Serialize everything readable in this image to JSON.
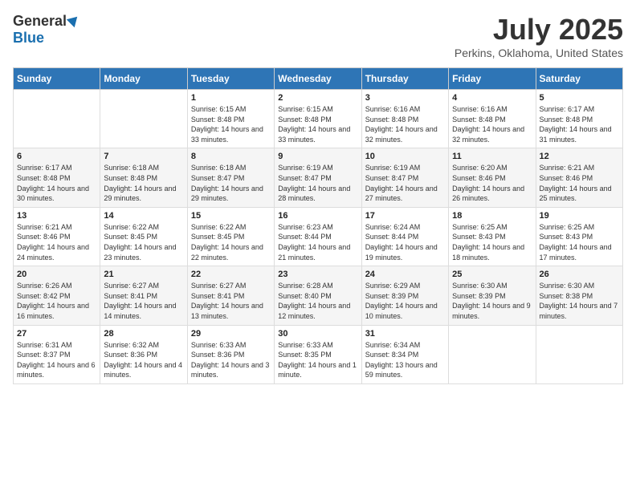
{
  "logo": {
    "general": "General",
    "blue": "Blue"
  },
  "title": "July 2025",
  "location": "Perkins, Oklahoma, United States",
  "days_of_week": [
    "Sunday",
    "Monday",
    "Tuesday",
    "Wednesday",
    "Thursday",
    "Friday",
    "Saturday"
  ],
  "weeks": [
    [
      {
        "day": "",
        "sunrise": "",
        "sunset": "",
        "daylight": ""
      },
      {
        "day": "",
        "sunrise": "",
        "sunset": "",
        "daylight": ""
      },
      {
        "day": "1",
        "sunrise": "Sunrise: 6:15 AM",
        "sunset": "Sunset: 8:48 PM",
        "daylight": "Daylight: 14 hours and 33 minutes."
      },
      {
        "day": "2",
        "sunrise": "Sunrise: 6:15 AM",
        "sunset": "Sunset: 8:48 PM",
        "daylight": "Daylight: 14 hours and 33 minutes."
      },
      {
        "day": "3",
        "sunrise": "Sunrise: 6:16 AM",
        "sunset": "Sunset: 8:48 PM",
        "daylight": "Daylight: 14 hours and 32 minutes."
      },
      {
        "day": "4",
        "sunrise": "Sunrise: 6:16 AM",
        "sunset": "Sunset: 8:48 PM",
        "daylight": "Daylight: 14 hours and 32 minutes."
      },
      {
        "day": "5",
        "sunrise": "Sunrise: 6:17 AM",
        "sunset": "Sunset: 8:48 PM",
        "daylight": "Daylight: 14 hours and 31 minutes."
      }
    ],
    [
      {
        "day": "6",
        "sunrise": "Sunrise: 6:17 AM",
        "sunset": "Sunset: 8:48 PM",
        "daylight": "Daylight: 14 hours and 30 minutes."
      },
      {
        "day": "7",
        "sunrise": "Sunrise: 6:18 AM",
        "sunset": "Sunset: 8:48 PM",
        "daylight": "Daylight: 14 hours and 29 minutes."
      },
      {
        "day": "8",
        "sunrise": "Sunrise: 6:18 AM",
        "sunset": "Sunset: 8:47 PM",
        "daylight": "Daylight: 14 hours and 29 minutes."
      },
      {
        "day": "9",
        "sunrise": "Sunrise: 6:19 AM",
        "sunset": "Sunset: 8:47 PM",
        "daylight": "Daylight: 14 hours and 28 minutes."
      },
      {
        "day": "10",
        "sunrise": "Sunrise: 6:19 AM",
        "sunset": "Sunset: 8:47 PM",
        "daylight": "Daylight: 14 hours and 27 minutes."
      },
      {
        "day": "11",
        "sunrise": "Sunrise: 6:20 AM",
        "sunset": "Sunset: 8:46 PM",
        "daylight": "Daylight: 14 hours and 26 minutes."
      },
      {
        "day": "12",
        "sunrise": "Sunrise: 6:21 AM",
        "sunset": "Sunset: 8:46 PM",
        "daylight": "Daylight: 14 hours and 25 minutes."
      }
    ],
    [
      {
        "day": "13",
        "sunrise": "Sunrise: 6:21 AM",
        "sunset": "Sunset: 8:46 PM",
        "daylight": "Daylight: 14 hours and 24 minutes."
      },
      {
        "day": "14",
        "sunrise": "Sunrise: 6:22 AM",
        "sunset": "Sunset: 8:45 PM",
        "daylight": "Daylight: 14 hours and 23 minutes."
      },
      {
        "day": "15",
        "sunrise": "Sunrise: 6:22 AM",
        "sunset": "Sunset: 8:45 PM",
        "daylight": "Daylight: 14 hours and 22 minutes."
      },
      {
        "day": "16",
        "sunrise": "Sunrise: 6:23 AM",
        "sunset": "Sunset: 8:44 PM",
        "daylight": "Daylight: 14 hours and 21 minutes."
      },
      {
        "day": "17",
        "sunrise": "Sunrise: 6:24 AM",
        "sunset": "Sunset: 8:44 PM",
        "daylight": "Daylight: 14 hours and 19 minutes."
      },
      {
        "day": "18",
        "sunrise": "Sunrise: 6:25 AM",
        "sunset": "Sunset: 8:43 PM",
        "daylight": "Daylight: 14 hours and 18 minutes."
      },
      {
        "day": "19",
        "sunrise": "Sunrise: 6:25 AM",
        "sunset": "Sunset: 8:43 PM",
        "daylight": "Daylight: 14 hours and 17 minutes."
      }
    ],
    [
      {
        "day": "20",
        "sunrise": "Sunrise: 6:26 AM",
        "sunset": "Sunset: 8:42 PM",
        "daylight": "Daylight: 14 hours and 16 minutes."
      },
      {
        "day": "21",
        "sunrise": "Sunrise: 6:27 AM",
        "sunset": "Sunset: 8:41 PM",
        "daylight": "Daylight: 14 hours and 14 minutes."
      },
      {
        "day": "22",
        "sunrise": "Sunrise: 6:27 AM",
        "sunset": "Sunset: 8:41 PM",
        "daylight": "Daylight: 14 hours and 13 minutes."
      },
      {
        "day": "23",
        "sunrise": "Sunrise: 6:28 AM",
        "sunset": "Sunset: 8:40 PM",
        "daylight": "Daylight: 14 hours and 12 minutes."
      },
      {
        "day": "24",
        "sunrise": "Sunrise: 6:29 AM",
        "sunset": "Sunset: 8:39 PM",
        "daylight": "Daylight: 14 hours and 10 minutes."
      },
      {
        "day": "25",
        "sunrise": "Sunrise: 6:30 AM",
        "sunset": "Sunset: 8:39 PM",
        "daylight": "Daylight: 14 hours and 9 minutes."
      },
      {
        "day": "26",
        "sunrise": "Sunrise: 6:30 AM",
        "sunset": "Sunset: 8:38 PM",
        "daylight": "Daylight: 14 hours and 7 minutes."
      }
    ],
    [
      {
        "day": "27",
        "sunrise": "Sunrise: 6:31 AM",
        "sunset": "Sunset: 8:37 PM",
        "daylight": "Daylight: 14 hours and 6 minutes."
      },
      {
        "day": "28",
        "sunrise": "Sunrise: 6:32 AM",
        "sunset": "Sunset: 8:36 PM",
        "daylight": "Daylight: 14 hours and 4 minutes."
      },
      {
        "day": "29",
        "sunrise": "Sunrise: 6:33 AM",
        "sunset": "Sunset: 8:36 PM",
        "daylight": "Daylight: 14 hours and 3 minutes."
      },
      {
        "day": "30",
        "sunrise": "Sunrise: 6:33 AM",
        "sunset": "Sunset: 8:35 PM",
        "daylight": "Daylight: 14 hours and 1 minute."
      },
      {
        "day": "31",
        "sunrise": "Sunrise: 6:34 AM",
        "sunset": "Sunset: 8:34 PM",
        "daylight": "Daylight: 13 hours and 59 minutes."
      },
      {
        "day": "",
        "sunrise": "",
        "sunset": "",
        "daylight": ""
      },
      {
        "day": "",
        "sunrise": "",
        "sunset": "",
        "daylight": ""
      }
    ]
  ]
}
